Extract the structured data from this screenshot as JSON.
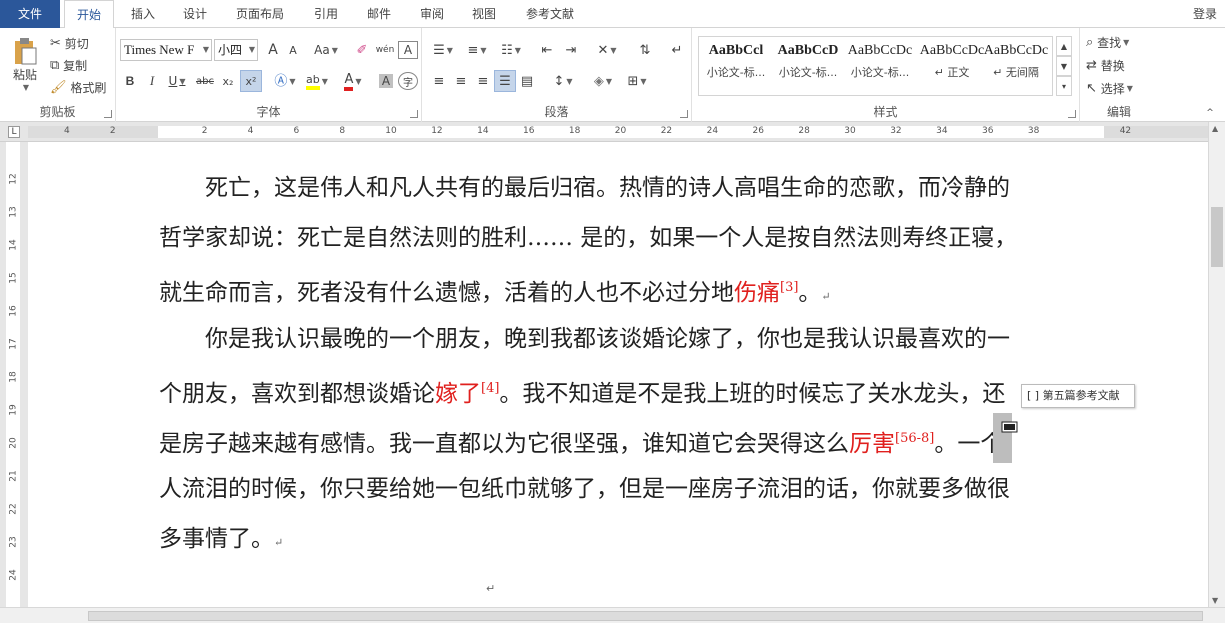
{
  "tabs": [
    "文件",
    "开始",
    "插入",
    "设计",
    "页面布局",
    "引用",
    "邮件",
    "审阅",
    "视图",
    "参考文献"
  ],
  "login": "登录",
  "clipboard": {
    "paste": "粘贴",
    "cut": "剪切",
    "copy": "复制",
    "format_painter": "格式刷",
    "label": "剪贴板"
  },
  "font": {
    "name": "Times New F",
    "size": "小四",
    "label": "字体",
    "case_btn": "Aa",
    "bold": "B",
    "italic": "I",
    "underline": "U",
    "strike": "abc",
    "sub": "x₂",
    "sup": "x²",
    "highlight": "ab",
    "color": "A",
    "phonetic": "wén",
    "char_border": "A",
    "char_shade": "A",
    "enclose": "字",
    "grow": "A",
    "shrink": "A"
  },
  "paragraph": {
    "label": "段落"
  },
  "styles": {
    "label": "样式",
    "items": [
      {
        "preview": "AaBbCcl",
        "name": "小论文-标..."
      },
      {
        "preview": "AaBbCcD",
        "name": "小论文-标..."
      },
      {
        "preview": "AaBbCcDc",
        "name": "小论文-标..."
      },
      {
        "preview": "AaBbCcDc",
        "name": "↵ 正文"
      },
      {
        "preview": "AaBbCcDc",
        "name": "↵ 无间隔"
      }
    ]
  },
  "editing": {
    "find": "查找",
    "replace": "替换",
    "select": "选择",
    "label": "编辑"
  },
  "ruler": {
    "h": [
      "4",
      "2",
      "",
      "2",
      "4",
      "6",
      "8",
      "10",
      "12",
      "14",
      "16",
      "18",
      "20",
      "22",
      "24",
      "26",
      "28",
      "30",
      "32",
      "34",
      "36",
      "38",
      "",
      "42"
    ],
    "v": [
      "12",
      "13",
      "14",
      "15",
      "16",
      "17",
      "18",
      "19",
      "20",
      "21",
      "22",
      "23",
      "24"
    ]
  },
  "doc": {
    "p1": {
      "l1": "　　死亡，这是伟人和凡人共有的最后归宿。热情的诗人高唱生命的恋歌，而冷静的",
      "l2": "哲学家却说：死亡是自然法则的胜利…… 是的，如果一个人是按自然法则寿终正寝，",
      "l3a": "就生命而言，死者没有什么遗憾，活着的人也不必过分地",
      "l3red": "伤痛",
      "l3sup": "[3]",
      "l3end": "。"
    },
    "p2": {
      "l1": "　　你是我认识最晚的一个朋友，晚到我都该谈婚论嫁了，你也是我认识最喜欢的一",
      "l2a": "个朋友，喜欢到都想谈婚论",
      "l2red": "嫁了",
      "l2sup": "[4]",
      "l2b": "。我不知道是不是我上班的时候忘了关水龙头，还",
      "l3a": "是房子越来越有感情。我一直都以为它很坚强，谁知道它会哭得这么",
      "l3red": "厉害",
      "l3sup": "[56-8]",
      "l3b": "。一个",
      "l4": "人流泪的时候，你只要给她一包纸巾就够了，但是一座房子流泪的话，你就要多做很",
      "l5": "多事情了。"
    },
    "para_mark": "↵"
  },
  "tooltip": "[ ] 第五篇参考文献"
}
